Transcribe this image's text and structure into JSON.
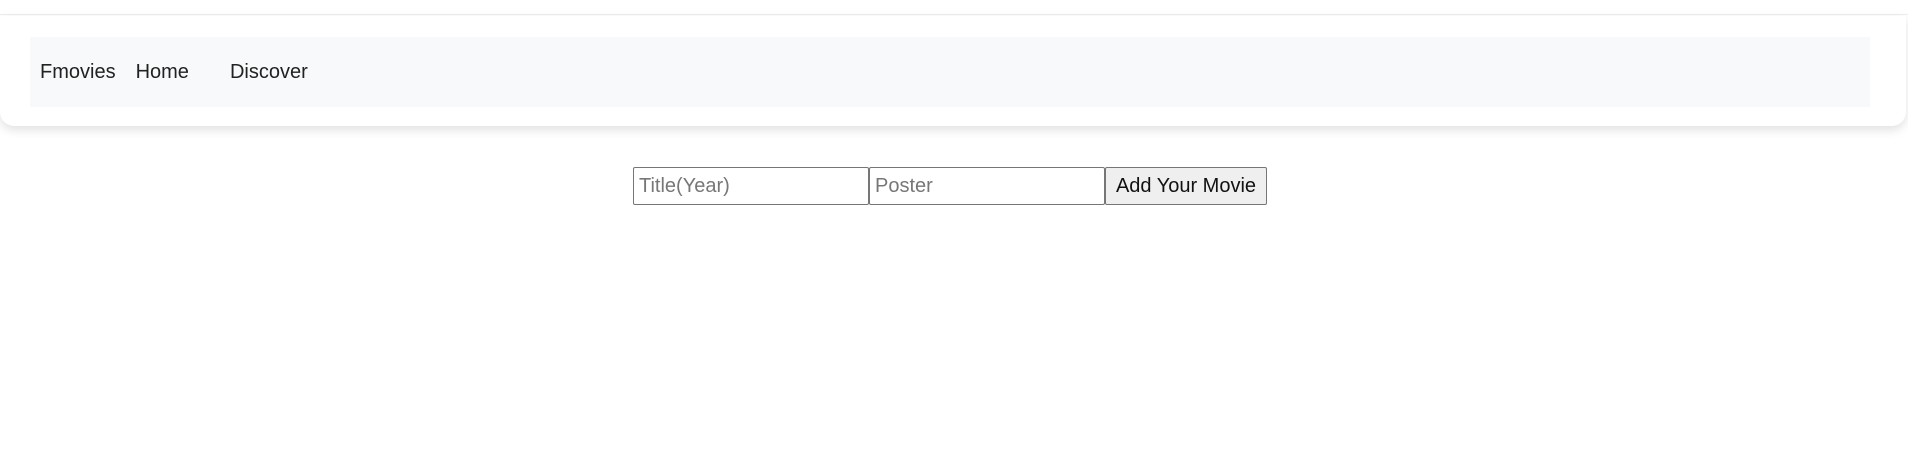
{
  "navbar": {
    "brand": "Fmovies",
    "links": [
      {
        "label": "Home"
      },
      {
        "label": "Discover"
      }
    ]
  },
  "add_movie_form": {
    "title_placeholder": "Title(Year)",
    "title_value": "",
    "poster_placeholder": "Poster",
    "poster_value": "",
    "submit_label": "Add Your Movie"
  },
  "colors": {
    "navbar_bg": "#f8f9fa",
    "button_bg": "#efefef",
    "text": "#222222"
  }
}
